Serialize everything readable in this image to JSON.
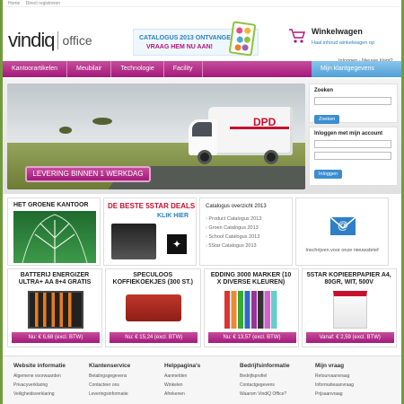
{
  "toplinks": [
    "Home",
    "Direct registreren"
  ],
  "logo": {
    "text": "vindiq",
    "sub": "office"
  },
  "promo": {
    "line1": "CATALOGUS 2013 ONTVANGEN?",
    "line2": "VRAAG HEM NU AAN!"
  },
  "cart": {
    "title": "Winkelwagen",
    "link": "Haal inhoud winkelwagen op",
    "login": "Inloggen - Nieuwe klant?"
  },
  "nav": {
    "items": [
      "Kantoorartikelen",
      "Meubilair",
      "Technologie",
      "Facility"
    ],
    "account": "Mijn klantgegevens"
  },
  "hero": {
    "banner": "LEVERING BINNEN 1 WERKDAG",
    "van_brand": "DPD"
  },
  "search": {
    "title": "Zoeken",
    "button": "Zoeken"
  },
  "login_box": {
    "title": "Inloggen met mijn account",
    "button": "Inloggen"
  },
  "promos": {
    "groen": {
      "title": "HET GROENE KANTOOR"
    },
    "deals": {
      "title": "DE BESTE 5STAR DEALS!",
      "link": "KLIK HIER"
    },
    "catalogues": {
      "title": "Catalogus overzicht 2013",
      "items": [
        "Product Catalogus 2013",
        "Groen Catalogus 2013",
        "School Catalogus 2013",
        "5Star Catalogus 2013"
      ]
    },
    "news": {
      "text": "Inschrijven voor onze nieuwsbrief"
    }
  },
  "products": [
    {
      "title": "BATTERIJ ENERGIZER ULTRA+ AA 8+4 GRATIS",
      "price": "Nu: € 6,68 (excl. BTW)"
    },
    {
      "title": "SPECULOOS KOFFIEKOEKJES (300 ST.)",
      "price": "Nu: € 15,24 (excl. BTW)"
    },
    {
      "title": "EDDING 3000 MARKER (10 X DIVERSE KLEUREN)",
      "price": "Nu: € 13,57 (excl. BTW)"
    },
    {
      "title": "5STAR KOPIEERPAPIER A4, 80GR, WIT, 500V",
      "price": "Vanaf: € 2,59 (excl. BTW)"
    }
  ],
  "footer": [
    {
      "head": "Website informatie",
      "links": [
        "Algemene voorwaarden",
        "Privacyverklaring",
        "Veiligheidsverklaring"
      ]
    },
    {
      "head": "Klantenservice",
      "links": [
        "Betalingsgegevens",
        "Contacteer ons",
        "Leveringsinformatie"
      ]
    },
    {
      "head": "Helppagina's",
      "links": [
        "Aanmelden",
        "Winkelen",
        "Afrekenen"
      ]
    },
    {
      "head": "Bedrijfsinformatie",
      "links": [
        "Bedrijfsprofiel",
        "Contactgegevens",
        "Waarom VindiQ Office?"
      ]
    },
    {
      "head": "Mijn vraag",
      "links": [
        "Retourvaanvraag",
        "Informatieaanvraag",
        "Prijsaanvraag"
      ]
    }
  ],
  "colors": {
    "magenta": "#a3197a",
    "blue": "#4f9fd7"
  }
}
